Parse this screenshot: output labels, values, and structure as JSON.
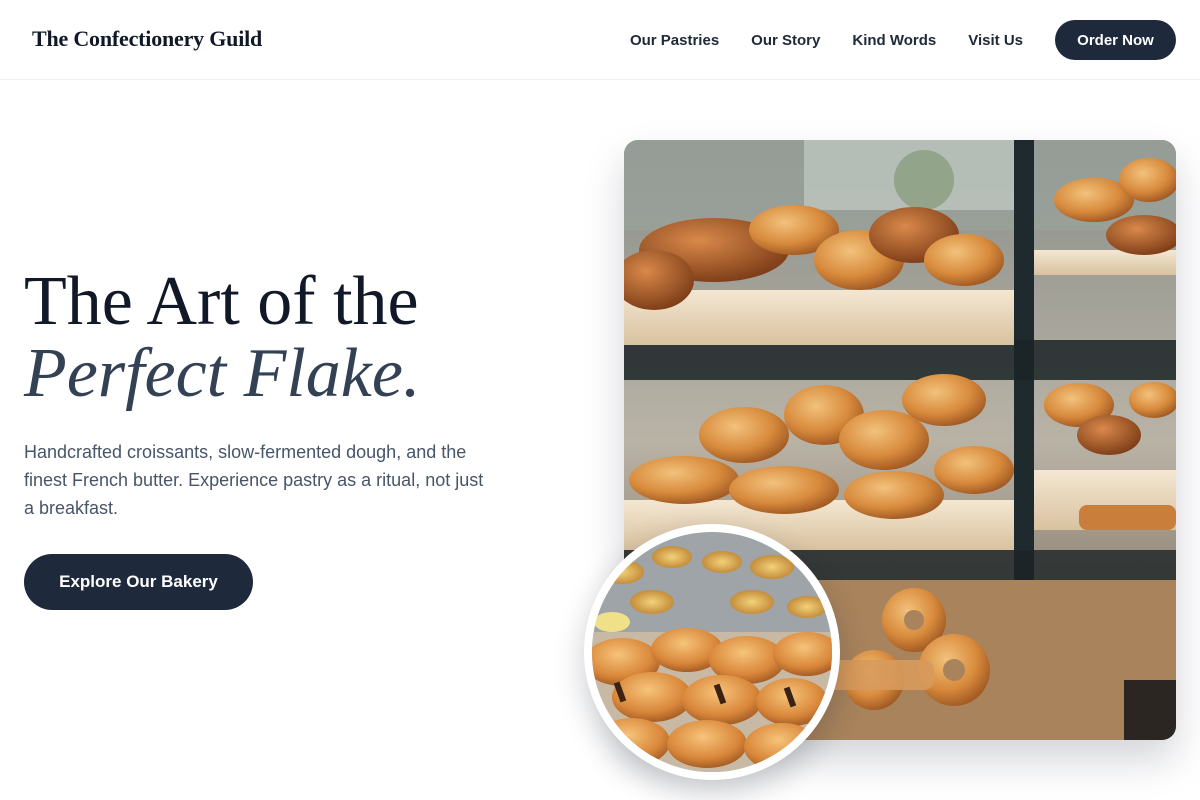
{
  "header": {
    "logo": "The Confectionery Guild",
    "nav": [
      "Our Pastries",
      "Our Story",
      "Kind Words",
      "Visit Us"
    ],
    "cta": "Order Now"
  },
  "hero": {
    "title_line1": "The Art of the",
    "title_line2": "Perfect Flake.",
    "description": "Handcrafted croissants, slow-fermented dough, and the finest French butter. Experience pastry as a ritual, not just a breakfast.",
    "button": "Explore Our Bakery"
  },
  "images": {
    "main": "bakery-display-case-photo",
    "circle": "pain-au-chocolat-tray-photo"
  },
  "colors": {
    "primary": "#1e293b",
    "heading": "#111827",
    "body_text": "#475569"
  }
}
